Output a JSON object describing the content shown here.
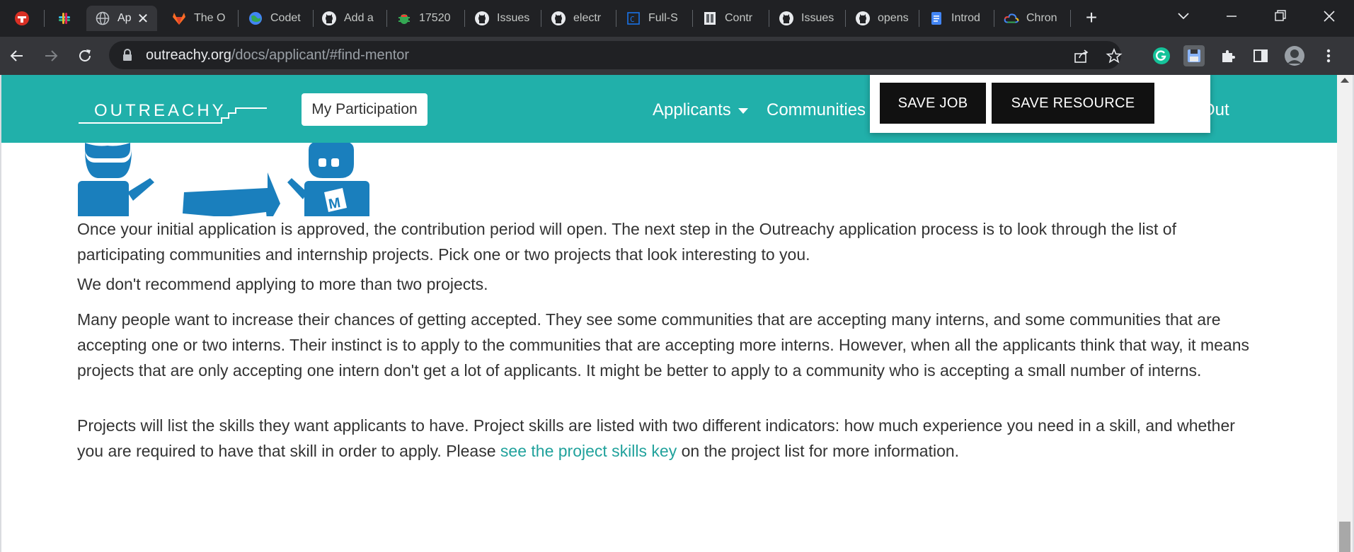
{
  "browser": {
    "tabs": [
      {
        "title": "",
        "icon": "red-app-icon"
      },
      {
        "title": "",
        "icon": "slack-icon"
      },
      {
        "title": "Ap",
        "icon": "globe-icon",
        "active": true
      },
      {
        "title": "The O",
        "icon": "gitlab-icon"
      },
      {
        "title": "Codet",
        "icon": "globe-icon"
      },
      {
        "title": "Add a",
        "icon": "github-icon"
      },
      {
        "title": "17520",
        "icon": "bug-icon"
      },
      {
        "title": "Issues",
        "icon": "github-icon"
      },
      {
        "title": "electr",
        "icon": "github-icon"
      },
      {
        "title": "Full-S",
        "icon": "code-icon"
      },
      {
        "title": "Contr",
        "icon": "doc-icon"
      },
      {
        "title": "Issues",
        "icon": "github-icon"
      },
      {
        "title": "opens",
        "icon": "github-icon"
      },
      {
        "title": "Introd",
        "icon": "google-docs-icon"
      },
      {
        "title": "Chron",
        "icon": "google-cloud-icon"
      }
    ],
    "new_tab_label": "+",
    "url_host": "outreachy.org",
    "url_path": "/docs/applicant/#find-mentor"
  },
  "header": {
    "logo_text": "OUTREACHY",
    "participation_label": "My Participation",
    "nav_applicants": "Applicants",
    "nav_communities": "Communities",
    "nav_logout_fragment": "g Out"
  },
  "popup": {
    "save_job": "SAVE JOB",
    "save_resource": "SAVE RESOURCE"
  },
  "illustration": {
    "badge_letter": "M"
  },
  "content": {
    "p1": "Once your initial application is approved, the contribution period will open. The next step in the Outreachy application process is to look through the list of participating communities and internship projects. Pick one or two projects that look interesting to you.",
    "p2": "We don't recommend applying to more than two projects.",
    "p3": "Many people want to increase their chances of getting accepted. They see some communities that are accepting many interns, and some communities that are accepting one or two interns. Their instinct is to apply to the communities that are accepting more interns. However, when all the applicants think that way, it means projects that are only accepting one intern don't get a lot of applicants. It might be better to apply to a community who is accepting a small number of interns.",
    "p4_before": "Projects will list the skills they want applicants to have. Project skills are listed with two different indicators: how much experience you need in a skill, and whether you are required to have that skill in order to apply. Please ",
    "p4_link": "see the project skills key",
    "p4_after": " on the project list for more information."
  },
  "colors": {
    "brand": "#21b0aa",
    "link": "#21a29c",
    "illustration": "#1a7fbd",
    "popup_button": "#111111"
  }
}
